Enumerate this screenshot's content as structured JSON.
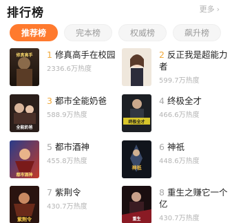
{
  "header": {
    "title": "排行榜",
    "more_label": "更多"
  },
  "tabs": [
    {
      "label": "推荐榜",
      "active": true
    },
    {
      "label": "完本榜",
      "active": false
    },
    {
      "label": "权威榜",
      "active": false
    },
    {
      "label": "飙升榜",
      "active": false
    }
  ],
  "books": [
    {
      "rank": "1",
      "title": "修真高手在校园",
      "heat": "2336.6万热度",
      "cover_text": "修真高手"
    },
    {
      "rank": "2",
      "title": "反正我是超能力者",
      "heat": "599.7万热度",
      "cover_text": ""
    },
    {
      "rank": "3",
      "title": "都市全能奶爸",
      "heat": "588.9万热度",
      "cover_text": "全能奶爸"
    },
    {
      "rank": "4",
      "title": "终极全才",
      "heat": "466.6万热度",
      "cover_text": "终极全才"
    },
    {
      "rank": "5",
      "title": "都市酒神",
      "heat": "455.8万热度",
      "cover_text": "都市酒神"
    },
    {
      "rank": "6",
      "title": "神祇",
      "heat": "448.6万热度",
      "cover_text": "神祇"
    },
    {
      "rank": "7",
      "title": "紫荆令",
      "heat": "430.7万热度",
      "cover_text": "紫荆令"
    },
    {
      "rank": "8",
      "title": "重生之赚它一个亿",
      "heat": "430.7万热度",
      "cover_text": "重生"
    }
  ],
  "colors": {
    "accent": "#ff7a2e",
    "rank_top": "#f0a93c"
  }
}
